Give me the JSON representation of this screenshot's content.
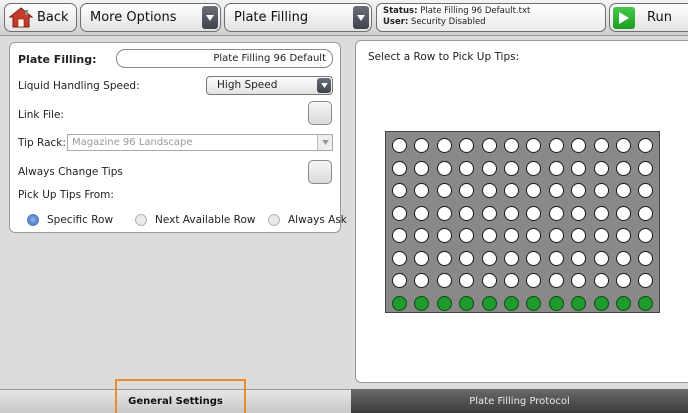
{
  "topbar": {
    "back_label": "Back",
    "options_label": "More Options",
    "protocol_label": "Plate Filling",
    "status_key": "Status:",
    "status_value": "Plate Filling 96 Default.txt",
    "user_key": "User:",
    "user_value": "Security Disabled",
    "run_label": "Run"
  },
  "settings": {
    "plate_filling_label": "Plate Filling:",
    "plate_filling_value": "Plate Filling 96 Default",
    "speed_label": "Liquid Handling Speed:",
    "speed_value": "High Speed",
    "link_label": "Link File:",
    "link_checked": false,
    "tiprack_label": "Tip Rack:",
    "tiprack_value": "Magazine 96 Landscape",
    "always_change_label": "Always Change Tips",
    "always_change_checked": false,
    "pickup_label": "Pick Up Tips From:",
    "pickup_options": [
      "Specific Row",
      "Next Available Row",
      "Always Ask"
    ],
    "pickup_selected": "Specific Row"
  },
  "plate": {
    "instruction": "Select a Row to Pick Up Tips:",
    "rows": 8,
    "cols": 12,
    "selected_row": 8,
    "selected_color": "#1f9a2c"
  },
  "tabs": {
    "general": "General Settings",
    "protocol": "Plate Filling Protocol",
    "active": "General Settings"
  },
  "colors": {
    "focus_outline": "#ee8a2e",
    "run_green": "#2db233"
  }
}
